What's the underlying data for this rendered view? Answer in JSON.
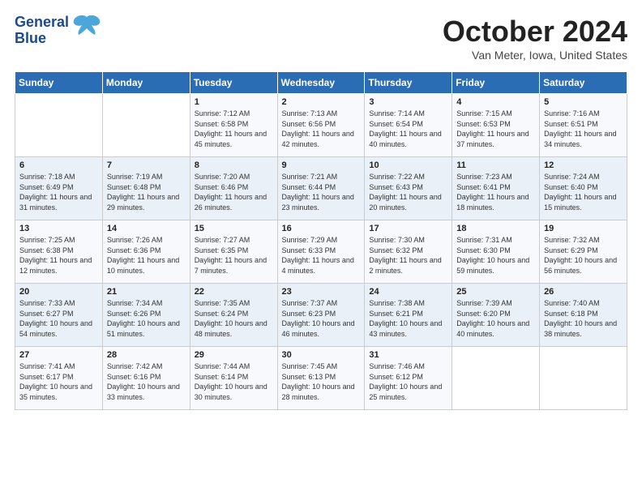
{
  "logo": {
    "line1": "General",
    "line2": "Blue"
  },
  "title": "October 2024",
  "location": "Van Meter, Iowa, United States",
  "days_of_week": [
    "Sunday",
    "Monday",
    "Tuesday",
    "Wednesday",
    "Thursday",
    "Friday",
    "Saturday"
  ],
  "weeks": [
    [
      {
        "day": null,
        "sunrise": null,
        "sunset": null,
        "daylight": null
      },
      {
        "day": null,
        "sunrise": null,
        "sunset": null,
        "daylight": null
      },
      {
        "day": "1",
        "sunrise": "Sunrise: 7:12 AM",
        "sunset": "Sunset: 6:58 PM",
        "daylight": "Daylight: 11 hours and 45 minutes."
      },
      {
        "day": "2",
        "sunrise": "Sunrise: 7:13 AM",
        "sunset": "Sunset: 6:56 PM",
        "daylight": "Daylight: 11 hours and 42 minutes."
      },
      {
        "day": "3",
        "sunrise": "Sunrise: 7:14 AM",
        "sunset": "Sunset: 6:54 PM",
        "daylight": "Daylight: 11 hours and 40 minutes."
      },
      {
        "day": "4",
        "sunrise": "Sunrise: 7:15 AM",
        "sunset": "Sunset: 6:53 PM",
        "daylight": "Daylight: 11 hours and 37 minutes."
      },
      {
        "day": "5",
        "sunrise": "Sunrise: 7:16 AM",
        "sunset": "Sunset: 6:51 PM",
        "daylight": "Daylight: 11 hours and 34 minutes."
      }
    ],
    [
      {
        "day": "6",
        "sunrise": "Sunrise: 7:18 AM",
        "sunset": "Sunset: 6:49 PM",
        "daylight": "Daylight: 11 hours and 31 minutes."
      },
      {
        "day": "7",
        "sunrise": "Sunrise: 7:19 AM",
        "sunset": "Sunset: 6:48 PM",
        "daylight": "Daylight: 11 hours and 29 minutes."
      },
      {
        "day": "8",
        "sunrise": "Sunrise: 7:20 AM",
        "sunset": "Sunset: 6:46 PM",
        "daylight": "Daylight: 11 hours and 26 minutes."
      },
      {
        "day": "9",
        "sunrise": "Sunrise: 7:21 AM",
        "sunset": "Sunset: 6:44 PM",
        "daylight": "Daylight: 11 hours and 23 minutes."
      },
      {
        "day": "10",
        "sunrise": "Sunrise: 7:22 AM",
        "sunset": "Sunset: 6:43 PM",
        "daylight": "Daylight: 11 hours and 20 minutes."
      },
      {
        "day": "11",
        "sunrise": "Sunrise: 7:23 AM",
        "sunset": "Sunset: 6:41 PM",
        "daylight": "Daylight: 11 hours and 18 minutes."
      },
      {
        "day": "12",
        "sunrise": "Sunrise: 7:24 AM",
        "sunset": "Sunset: 6:40 PM",
        "daylight": "Daylight: 11 hours and 15 minutes."
      }
    ],
    [
      {
        "day": "13",
        "sunrise": "Sunrise: 7:25 AM",
        "sunset": "Sunset: 6:38 PM",
        "daylight": "Daylight: 11 hours and 12 minutes."
      },
      {
        "day": "14",
        "sunrise": "Sunrise: 7:26 AM",
        "sunset": "Sunset: 6:36 PM",
        "daylight": "Daylight: 11 hours and 10 minutes."
      },
      {
        "day": "15",
        "sunrise": "Sunrise: 7:27 AM",
        "sunset": "Sunset: 6:35 PM",
        "daylight": "Daylight: 11 hours and 7 minutes."
      },
      {
        "day": "16",
        "sunrise": "Sunrise: 7:29 AM",
        "sunset": "Sunset: 6:33 PM",
        "daylight": "Daylight: 11 hours and 4 minutes."
      },
      {
        "day": "17",
        "sunrise": "Sunrise: 7:30 AM",
        "sunset": "Sunset: 6:32 PM",
        "daylight": "Daylight: 11 hours and 2 minutes."
      },
      {
        "day": "18",
        "sunrise": "Sunrise: 7:31 AM",
        "sunset": "Sunset: 6:30 PM",
        "daylight": "Daylight: 10 hours and 59 minutes."
      },
      {
        "day": "19",
        "sunrise": "Sunrise: 7:32 AM",
        "sunset": "Sunset: 6:29 PM",
        "daylight": "Daylight: 10 hours and 56 minutes."
      }
    ],
    [
      {
        "day": "20",
        "sunrise": "Sunrise: 7:33 AM",
        "sunset": "Sunset: 6:27 PM",
        "daylight": "Daylight: 10 hours and 54 minutes."
      },
      {
        "day": "21",
        "sunrise": "Sunrise: 7:34 AM",
        "sunset": "Sunset: 6:26 PM",
        "daylight": "Daylight: 10 hours and 51 minutes."
      },
      {
        "day": "22",
        "sunrise": "Sunrise: 7:35 AM",
        "sunset": "Sunset: 6:24 PM",
        "daylight": "Daylight: 10 hours and 48 minutes."
      },
      {
        "day": "23",
        "sunrise": "Sunrise: 7:37 AM",
        "sunset": "Sunset: 6:23 PM",
        "daylight": "Daylight: 10 hours and 46 minutes."
      },
      {
        "day": "24",
        "sunrise": "Sunrise: 7:38 AM",
        "sunset": "Sunset: 6:21 PM",
        "daylight": "Daylight: 10 hours and 43 minutes."
      },
      {
        "day": "25",
        "sunrise": "Sunrise: 7:39 AM",
        "sunset": "Sunset: 6:20 PM",
        "daylight": "Daylight: 10 hours and 40 minutes."
      },
      {
        "day": "26",
        "sunrise": "Sunrise: 7:40 AM",
        "sunset": "Sunset: 6:18 PM",
        "daylight": "Daylight: 10 hours and 38 minutes."
      }
    ],
    [
      {
        "day": "27",
        "sunrise": "Sunrise: 7:41 AM",
        "sunset": "Sunset: 6:17 PM",
        "daylight": "Daylight: 10 hours and 35 minutes."
      },
      {
        "day": "28",
        "sunrise": "Sunrise: 7:42 AM",
        "sunset": "Sunset: 6:16 PM",
        "daylight": "Daylight: 10 hours and 33 minutes."
      },
      {
        "day": "29",
        "sunrise": "Sunrise: 7:44 AM",
        "sunset": "Sunset: 6:14 PM",
        "daylight": "Daylight: 10 hours and 30 minutes."
      },
      {
        "day": "30",
        "sunrise": "Sunrise: 7:45 AM",
        "sunset": "Sunset: 6:13 PM",
        "daylight": "Daylight: 10 hours and 28 minutes."
      },
      {
        "day": "31",
        "sunrise": "Sunrise: 7:46 AM",
        "sunset": "Sunset: 6:12 PM",
        "daylight": "Daylight: 10 hours and 25 minutes."
      },
      {
        "day": null,
        "sunrise": null,
        "sunset": null,
        "daylight": null
      },
      {
        "day": null,
        "sunrise": null,
        "sunset": null,
        "daylight": null
      }
    ]
  ]
}
